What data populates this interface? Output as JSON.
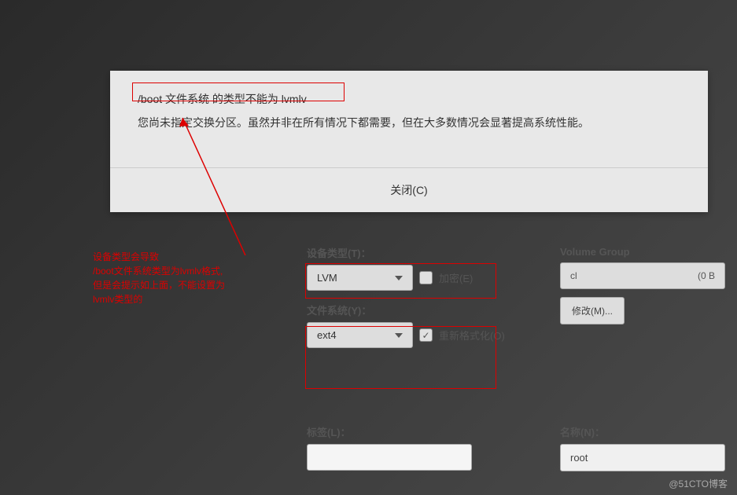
{
  "dialog": {
    "error_line1": "/boot 文件系统 的类型不能为 lvmlv",
    "error_line2": "您尚未指定交换分区。虽然并非在所有情况下都需要，但在大多数情况会显著提高系统性能。",
    "close_label": "关闭(C)"
  },
  "annotation": {
    "line1": "设备类型会导致",
    "line2": "/boot文件系统类型为lvmlv格式,",
    "line3": "但是会提示如上面，不能设置为",
    "line4": "lvmlv类型的"
  },
  "form": {
    "device_type_label": "设备类型(T)：",
    "device_type_value": "LVM",
    "encrypt_label": "加密(E)",
    "fs_label": "文件系统(Y)：",
    "fs_value": "ext4",
    "reformat_label": "重新格式化(O)",
    "tag_label": "标签(L)：",
    "tag_value": ""
  },
  "right": {
    "vg_label": "Volume Group",
    "vg_value": "cl",
    "vg_free": "(0 B",
    "modify_label": "修改(M)...",
    "name_label": "名称(N)：",
    "name_value": "root"
  },
  "watermark": "@51CTO博客"
}
